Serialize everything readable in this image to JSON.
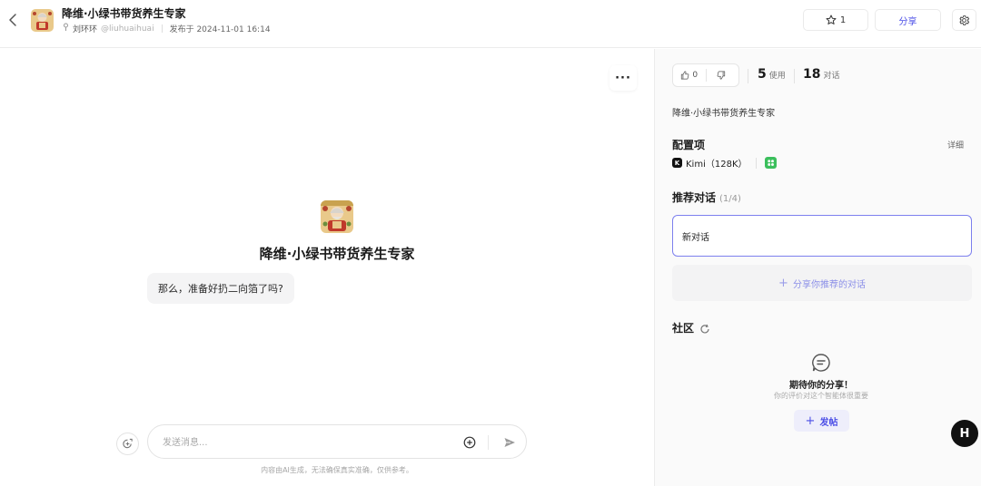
{
  "header": {
    "title": "降维·小绿书带货养生专家",
    "author": "刘环环",
    "handle": "@liuhuaihuai",
    "published": "发布于  2024-11-01 16:14",
    "star_count": "1",
    "share_label": "分享"
  },
  "main": {
    "bot_name": "降维·小绿书带货养生专家",
    "greeting": "那么，准备好扔二向箔了吗?",
    "input_placeholder": "发送消息...",
    "disclaimer": "内容由AI生成，无法确保真实准确，仅供参考。"
  },
  "sidebar": {
    "likes": "0",
    "uses_count": "5",
    "uses_label": "使用",
    "chats_count": "18",
    "chats_label": "对话",
    "description": "降维·小绿书带货养生专家",
    "config_title": "配置项",
    "detail_label": "详细",
    "model_name": "Kimi（128K）",
    "recommended_title": "推荐对话",
    "recommended_count": "(1/4)",
    "recommended_items": [
      "新对话"
    ],
    "share_recommend_label": "分享你推荐的对话",
    "community_title": "社区",
    "empty_title": "期待你的分享！",
    "empty_subtitle": "你的评价对这个智能体很重要",
    "post_label": "发帖"
  },
  "colors": {
    "accent": "#4b4ee6",
    "card_border": "#7d80ee",
    "plugin_green": "#3bbf5c"
  },
  "icons": [
    "back-arrow-icon",
    "star-icon",
    "gear-icon",
    "more-icon",
    "new-chat-icon",
    "plus-circle-icon",
    "send-icon",
    "thumb-up-icon",
    "thumb-down-icon",
    "refresh-icon",
    "chat-bubble-icon"
  ]
}
